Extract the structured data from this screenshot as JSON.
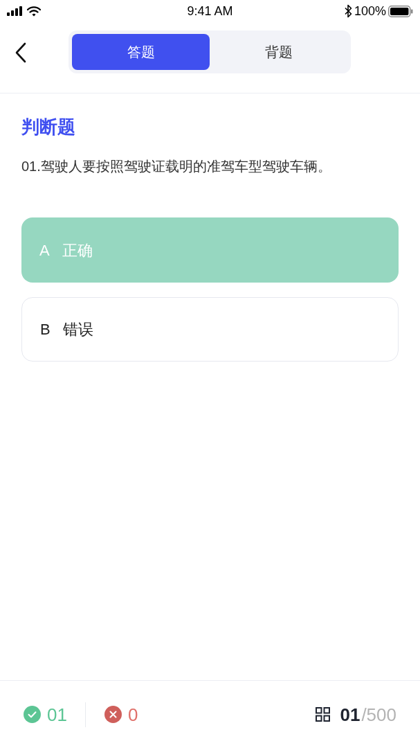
{
  "status_bar": {
    "time": "9:41 AM",
    "battery": "100%"
  },
  "header": {
    "tabs": [
      {
        "label": "答题",
        "selected": true
      },
      {
        "label": "背题",
        "selected": false
      }
    ]
  },
  "question": {
    "type": "判断题",
    "text": "01.驾驶人要按照驾驶证载明的准驾车型驾驶车辆。",
    "options": [
      {
        "letter": "A",
        "text": "正确",
        "selected": true
      },
      {
        "letter": "B",
        "text": "错误",
        "selected": false
      }
    ]
  },
  "footer": {
    "correct": "01",
    "wrong": "0",
    "current": "01",
    "total": "/500"
  }
}
